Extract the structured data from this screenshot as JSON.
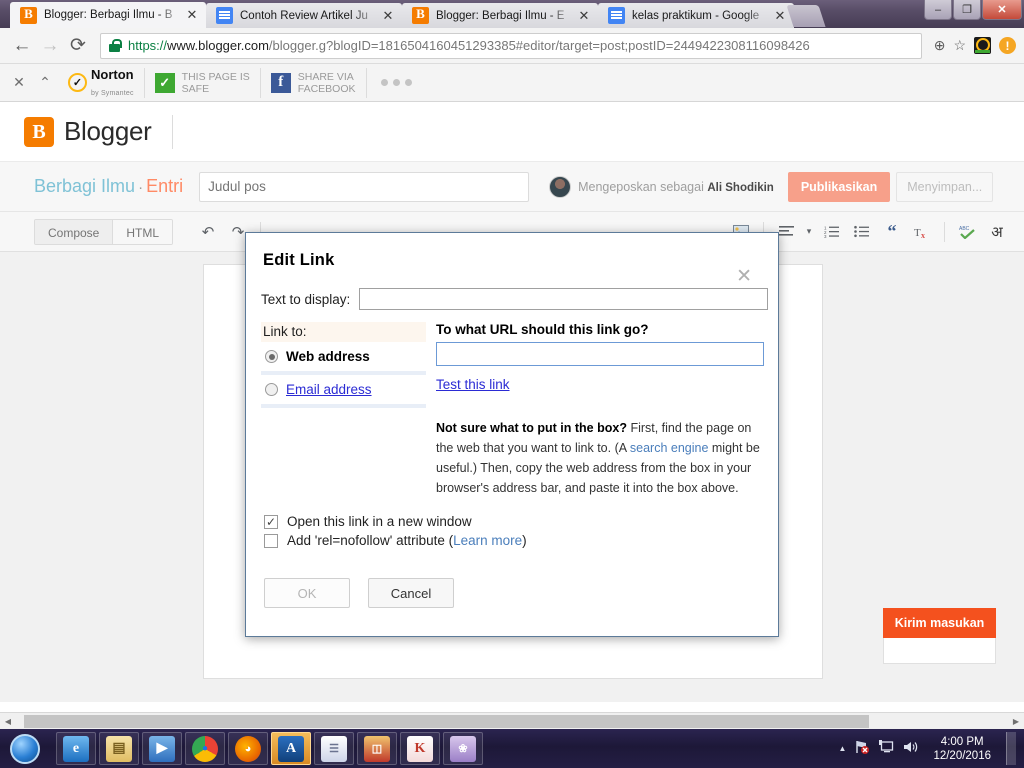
{
  "browser": {
    "tabs": [
      {
        "title": "Blogger: Berbagi Ilmu - B",
        "favicon": "blogger-icon",
        "active": true
      },
      {
        "title": "Contoh Review Artikel Ju",
        "favicon": "google-docs-icon",
        "active": false
      },
      {
        "title": "Blogger: Berbagi Ilmu - E",
        "favicon": "blogger-icon",
        "active": false
      },
      {
        "title": "kelas praktikum - Google",
        "favicon": "google-docs-icon",
        "active": false
      }
    ],
    "tab_close_label": "✕",
    "window_controls": {
      "minimize": "–",
      "maximize": "❐",
      "close": "✕"
    },
    "nav": {
      "back": "←",
      "forward": "→",
      "reload": "⟳"
    },
    "url": {
      "scheme": "https://",
      "host": "www.blogger.com",
      "rest": "/blogger.g?blogID=1816504160451293385#editor/target=post;postID=2449422308116098426",
      "secure": true
    },
    "omnibox_icons": {
      "zoom": "⊕",
      "bookmark_star": "☆",
      "norton_ext": "norton-icon",
      "warning": "!"
    }
  },
  "bookmarks": {
    "controls": {
      "close": "✕",
      "collapse": "⌃"
    },
    "items": [
      {
        "name": "norton",
        "primary": "Norton",
        "secondary": "by Symantec"
      },
      {
        "name": "page-safe",
        "line1": "THIS PAGE IS",
        "line2": "SAFE"
      },
      {
        "name": "share-facebook",
        "line1": "SHARE VIA",
        "line2": "FACEBOOK"
      }
    ],
    "overflow": "•••"
  },
  "blogger": {
    "brand": "Blogger",
    "brand_mark": "B",
    "blog_name": "Berbagi Ilmu",
    "separator": "·",
    "section": "Entri",
    "title_placeholder": "Judul pos",
    "title_value": "",
    "posting_as_label": "Mengeposkan sebagai",
    "author": "Ali Shodikin",
    "publish_label": "Publikasikan",
    "saving_label": "Menyimpan...",
    "modes": {
      "compose": "Compose",
      "html": "HTML"
    },
    "toolbar_icons": {
      "undo": "↶",
      "redo": "↷",
      "image": "image-icon",
      "align": "≡",
      "align_caret": "▾",
      "numbered_list": "numbered-list-icon",
      "bulleted_list": "bulleted-list-icon",
      "blockquote": "“",
      "remove_format": "Tx",
      "spellcheck": "spellcheck-icon",
      "transliteration": "अ"
    },
    "feedback_label": "Kirim masukan"
  },
  "dialog": {
    "title": "Edit Link",
    "close": "✕",
    "text_to_display_label": "Text to display:",
    "text_to_display_value": "",
    "link_to_label": "Link to:",
    "options": [
      {
        "label": "Web address",
        "selected": true
      },
      {
        "label": "Email address",
        "selected": false
      }
    ],
    "url_question": "To what URL should this link go?",
    "url_value": "",
    "test_link_label": "Test this link",
    "help": {
      "bold_lead": "Not sure what to put in the box?",
      "part1": " First, find the page on the web that you want to link to. (A ",
      "link": "search engine",
      "part2": " might be useful.) Then, copy the web address from the box in your browser's address bar, and paste it into the box above."
    },
    "checkboxes": [
      {
        "label": "Open this link in a new window",
        "checked": true,
        "mark": "✓"
      },
      {
        "label": "Add 'rel=nofollow' attribute (",
        "checked": false,
        "mark": "",
        "link": "Learn more",
        "suffix": ")"
      }
    ],
    "ok_label": "OK",
    "cancel_label": "Cancel"
  },
  "taskbar": {
    "start": "start-orb",
    "apps": [
      {
        "name": "internet-explorer",
        "glyph": "e",
        "color": "#1c6fc0",
        "active": false
      },
      {
        "name": "file-explorer",
        "glyph": "▤",
        "color": "#e8c66a",
        "active": false
      },
      {
        "name": "media-player",
        "glyph": "▶",
        "color": "#2f6fbd",
        "active": false
      },
      {
        "name": "google-chrome",
        "glyph": "●",
        "color": "#34a853",
        "active": false
      },
      {
        "name": "mozilla-firefox",
        "glyph": "◕",
        "color": "#e66000",
        "active": false
      },
      {
        "name": "avira-antivirus",
        "glyph": "A",
        "color": "#1b5fa8",
        "active": true
      },
      {
        "name": "notepad",
        "glyph": "☰",
        "color": "#dfe4f2",
        "active": false
      },
      {
        "name": "winrar",
        "glyph": "◫",
        "color": "#b32d2d",
        "active": false
      },
      {
        "name": "kingsoft-office",
        "glyph": "K",
        "color": "#c0392b",
        "active": false
      },
      {
        "name": "paint",
        "glyph": "❀",
        "color": "#8e6fc0",
        "active": false
      }
    ],
    "tray": {
      "overflow": "▲",
      "network": "network-icon",
      "display": "display-icon",
      "volume": "volume-icon"
    },
    "clock_time": "4:00 PM",
    "clock_date": "12/20/2016"
  },
  "colors": {
    "blogger_orange": "#f57c00",
    "publish_button": "#f7a08a",
    "feedback_orange": "#f4511e",
    "link_blue": "#2b2bd4",
    "help_link_blue": "#4a7ebb",
    "secure_green": "#0b8043"
  }
}
